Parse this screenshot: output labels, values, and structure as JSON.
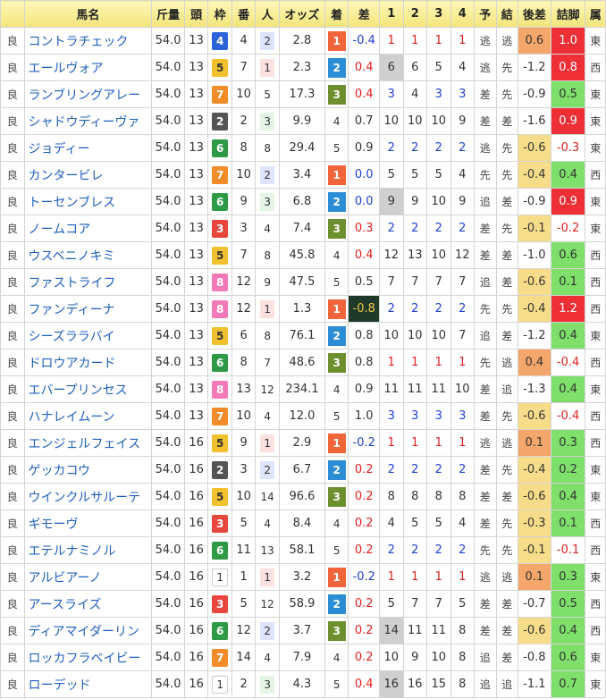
{
  "headers": [
    "",
    "馬名",
    "斤量",
    "頭",
    "枠",
    "番",
    "人",
    "オッズ",
    "着",
    "差",
    "1",
    "2",
    "3",
    "4",
    "予",
    "結",
    "後差",
    "詰脚",
    "属"
  ],
  "rows": [
    {
      "cond": "良",
      "name": "コントラチェック",
      "kg": "54.0",
      "heads": "13",
      "waku": "4",
      "ban": "4",
      "pop": "2",
      "odds": "2.8",
      "fin": "1",
      "diff": "-0.4",
      "c1": "1",
      "c2": "1",
      "c3": "1",
      "c4": "1",
      "yo": "逃",
      "ketsu": "逃",
      "late": "0.6",
      "tsume": "1.0",
      "dir": "東"
    },
    {
      "cond": "良",
      "name": "エールヴォア",
      "kg": "54.0",
      "heads": "13",
      "waku": "5",
      "ban": "7",
      "pop": "1",
      "odds": "2.3",
      "fin": "2",
      "diff": "0.4",
      "c1": "6",
      "c2": "6",
      "c3": "5",
      "c4": "4",
      "yo": "逃",
      "ketsu": "先",
      "late": "-1.2",
      "tsume": "0.8",
      "dir": "西"
    },
    {
      "cond": "良",
      "name": "ランブリングアレー",
      "kg": "54.0",
      "heads": "13",
      "waku": "7",
      "ban": "10",
      "pop": "5",
      "odds": "17.3",
      "fin": "3",
      "diff": "0.4",
      "c1": "3",
      "c2": "4",
      "c3": "3",
      "c4": "3",
      "yo": "差",
      "ketsu": "先",
      "late": "-0.9",
      "tsume": "0.5",
      "dir": "東"
    },
    {
      "cond": "良",
      "name": "シャドウディーヴァ",
      "kg": "54.0",
      "heads": "13",
      "waku": "2",
      "ban": "2",
      "pop": "3",
      "odds": "9.9",
      "fin": "4",
      "diff": "0.7",
      "c1": "10",
      "c2": "10",
      "c3": "10",
      "c4": "9",
      "yo": "差",
      "ketsu": "差",
      "late": "-1.6",
      "tsume": "0.9",
      "dir": "東"
    },
    {
      "cond": "良",
      "name": "ジョディー",
      "kg": "54.0",
      "heads": "13",
      "waku": "6",
      "ban": "8",
      "pop": "8",
      "odds": "29.4",
      "fin": "5",
      "diff": "0.9",
      "c1": "2",
      "c2": "2",
      "c3": "2",
      "c4": "2",
      "yo": "逃",
      "ketsu": "先",
      "late": "-0.6",
      "tsume": "-0.3",
      "dir": "東"
    },
    {
      "cond": "良",
      "name": "カンタービレ",
      "kg": "54.0",
      "heads": "13",
      "waku": "7",
      "ban": "10",
      "pop": "2",
      "odds": "3.4",
      "fin": "1",
      "diff": "0.0",
      "c1": "5",
      "c2": "5",
      "c3": "5",
      "c4": "4",
      "yo": "先",
      "ketsu": "先",
      "late": "-0.4",
      "tsume": "0.4",
      "dir": "西"
    },
    {
      "cond": "良",
      "name": "トーセンブレス",
      "kg": "54.0",
      "heads": "13",
      "waku": "6",
      "ban": "9",
      "pop": "3",
      "odds": "6.8",
      "fin": "2",
      "diff": "0.0",
      "c1": "9",
      "c2": "9",
      "c3": "10",
      "c4": "9",
      "yo": "追",
      "ketsu": "差",
      "late": "-0.9",
      "tsume": "0.9",
      "dir": "東"
    },
    {
      "cond": "良",
      "name": "ノームコア",
      "kg": "54.0",
      "heads": "13",
      "waku": "3",
      "ban": "3",
      "pop": "4",
      "odds": "7.4",
      "fin": "3",
      "diff": "0.3",
      "c1": "2",
      "c2": "2",
      "c3": "2",
      "c4": "2",
      "yo": "差",
      "ketsu": "先",
      "late": "-0.1",
      "tsume": "-0.2",
      "dir": "東"
    },
    {
      "cond": "良",
      "name": "ウスベニノキミ",
      "kg": "54.0",
      "heads": "13",
      "waku": "5",
      "ban": "7",
      "pop": "8",
      "odds": "45.8",
      "fin": "4",
      "diff": "0.4",
      "c1": "12",
      "c2": "13",
      "c3": "10",
      "c4": "12",
      "yo": "差",
      "ketsu": "差",
      "late": "-1.0",
      "tsume": "0.6",
      "dir": "西"
    },
    {
      "cond": "良",
      "name": "ファストライフ",
      "kg": "54.0",
      "heads": "13",
      "waku": "8",
      "ban": "12",
      "pop": "9",
      "odds": "47.5",
      "fin": "5",
      "diff": "0.5",
      "c1": "7",
      "c2": "7",
      "c3": "7",
      "c4": "7",
      "yo": "追",
      "ketsu": "差",
      "late": "-0.6",
      "tsume": "0.1",
      "dir": "西"
    },
    {
      "cond": "良",
      "name": "ファンディーナ",
      "kg": "54.0",
      "heads": "13",
      "waku": "8",
      "ban": "12",
      "pop": "1",
      "odds": "1.3",
      "fin": "1",
      "diff": "-0.8",
      "c1": "2",
      "c2": "2",
      "c3": "2",
      "c4": "2",
      "yo": "先",
      "ketsu": "先",
      "late": "-0.4",
      "tsume": "1.2",
      "dir": "西"
    },
    {
      "cond": "良",
      "name": "シーズララバイ",
      "kg": "54.0",
      "heads": "13",
      "waku": "5",
      "ban": "6",
      "pop": "8",
      "odds": "76.1",
      "fin": "2",
      "diff": "0.8",
      "c1": "10",
      "c2": "10",
      "c3": "10",
      "c4": "7",
      "yo": "追",
      "ketsu": "差",
      "late": "-1.2",
      "tsume": "0.4",
      "dir": "東"
    },
    {
      "cond": "良",
      "name": "ドロウアカード",
      "kg": "54.0",
      "heads": "13",
      "waku": "6",
      "ban": "8",
      "pop": "7",
      "odds": "48.6",
      "fin": "3",
      "diff": "0.8",
      "c1": "1",
      "c2": "1",
      "c3": "1",
      "c4": "1",
      "yo": "先",
      "ketsu": "逃",
      "late": "0.4",
      "tsume": "-0.4",
      "dir": "西"
    },
    {
      "cond": "良",
      "name": "エバープリンセス",
      "kg": "54.0",
      "heads": "13",
      "waku": "8",
      "ban": "13",
      "pop": "12",
      "odds": "234.1",
      "fin": "4",
      "diff": "0.9",
      "c1": "11",
      "c2": "11",
      "c3": "11",
      "c4": "10",
      "yo": "差",
      "ketsu": "追",
      "late": "-1.3",
      "tsume": "0.4",
      "dir": "東"
    },
    {
      "cond": "良",
      "name": "ハナレイムーン",
      "kg": "54.0",
      "heads": "13",
      "waku": "7",
      "ban": "10",
      "pop": "4",
      "odds": "12.0",
      "fin": "5",
      "diff": "1.0",
      "c1": "3",
      "c2": "3",
      "c3": "3",
      "c4": "3",
      "yo": "差",
      "ketsu": "先",
      "late": "-0.6",
      "tsume": "-0.4",
      "dir": "西"
    },
    {
      "cond": "良",
      "name": "エンジェルフェイス",
      "kg": "54.0",
      "heads": "16",
      "waku": "5",
      "ban": "9",
      "pop": "1",
      "odds": "2.9",
      "fin": "1",
      "diff": "-0.2",
      "c1": "1",
      "c2": "1",
      "c3": "1",
      "c4": "1",
      "yo": "逃",
      "ketsu": "逃",
      "late": "0.1",
      "tsume": "0.3",
      "dir": "西"
    },
    {
      "cond": "良",
      "name": "ゲッカコウ",
      "kg": "54.0",
      "heads": "16",
      "waku": "2",
      "ban": "3",
      "pop": "2",
      "odds": "6.7",
      "fin": "2",
      "diff": "0.2",
      "c1": "2",
      "c2": "2",
      "c3": "2",
      "c4": "2",
      "yo": "差",
      "ketsu": "先",
      "late": "-0.4",
      "tsume": "0.2",
      "dir": "東"
    },
    {
      "cond": "良",
      "name": "ウインクルサルーテ",
      "kg": "54.0",
      "heads": "16",
      "waku": "5",
      "ban": "10",
      "pop": "14",
      "odds": "96.6",
      "fin": "3",
      "diff": "0.2",
      "c1": "8",
      "c2": "8",
      "c3": "8",
      "c4": "8",
      "yo": "差",
      "ketsu": "差",
      "late": "-0.6",
      "tsume": "0.4",
      "dir": "東"
    },
    {
      "cond": "良",
      "name": "ギモーヴ",
      "kg": "54.0",
      "heads": "16",
      "waku": "3",
      "ban": "5",
      "pop": "4",
      "odds": "8.4",
      "fin": "4",
      "diff": "0.2",
      "c1": "4",
      "c2": "5",
      "c3": "5",
      "c4": "4",
      "yo": "差",
      "ketsu": "先",
      "late": "-0.3",
      "tsume": "0.1",
      "dir": "西"
    },
    {
      "cond": "良",
      "name": "エテルナミノル",
      "kg": "54.0",
      "heads": "16",
      "waku": "6",
      "ban": "11",
      "pop": "13",
      "odds": "58.1",
      "fin": "5",
      "diff": "0.2",
      "c1": "2",
      "c2": "2",
      "c3": "2",
      "c4": "2",
      "yo": "先",
      "ketsu": "先",
      "late": "-0.1",
      "tsume": "-0.1",
      "dir": "西"
    },
    {
      "cond": "良",
      "name": "アルビアーノ",
      "kg": "54.0",
      "heads": "16",
      "waku": "1",
      "ban": "1",
      "pop": "1",
      "odds": "3.2",
      "fin": "1",
      "diff": "-0.2",
      "c1": "1",
      "c2": "1",
      "c3": "1",
      "c4": "1",
      "yo": "逃",
      "ketsu": "逃",
      "late": "0.1",
      "tsume": "0.3",
      "dir": "東"
    },
    {
      "cond": "良",
      "name": "アースライズ",
      "kg": "54.0",
      "heads": "16",
      "waku": "3",
      "ban": "5",
      "pop": "12",
      "odds": "58.9",
      "fin": "2",
      "diff": "0.2",
      "c1": "5",
      "c2": "7",
      "c3": "7",
      "c4": "5",
      "yo": "差",
      "ketsu": "差",
      "late": "-0.7",
      "tsume": "0.5",
      "dir": "西"
    },
    {
      "cond": "良",
      "name": "ディアマイダーリン",
      "kg": "54.0",
      "heads": "16",
      "waku": "6",
      "ban": "12",
      "pop": "2",
      "odds": "3.7",
      "fin": "3",
      "diff": "0.2",
      "c1": "14",
      "c2": "11",
      "c3": "11",
      "c4": "8",
      "yo": "差",
      "ketsu": "差",
      "late": "-0.6",
      "tsume": "0.4",
      "dir": "西"
    },
    {
      "cond": "良",
      "name": "ロッカフラベイビー",
      "kg": "54.0",
      "heads": "16",
      "waku": "7",
      "ban": "14",
      "pop": "4",
      "odds": "7.9",
      "fin": "4",
      "diff": "0.2",
      "c1": "10",
      "c2": "9",
      "c3": "10",
      "c4": "8",
      "yo": "追",
      "ketsu": "差",
      "late": "-0.8",
      "tsume": "0.6",
      "dir": "東"
    },
    {
      "cond": "良",
      "name": "ローデッド",
      "kg": "54.0",
      "heads": "16",
      "waku": "1",
      "ban": "2",
      "pop": "3",
      "odds": "4.3",
      "fin": "5",
      "diff": "0.4",
      "c1": "16",
      "c2": "16",
      "c3": "15",
      "c4": "8",
      "yo": "追",
      "ketsu": "追",
      "late": "-1.1",
      "tsume": "0.7",
      "dir": "東"
    }
  ]
}
